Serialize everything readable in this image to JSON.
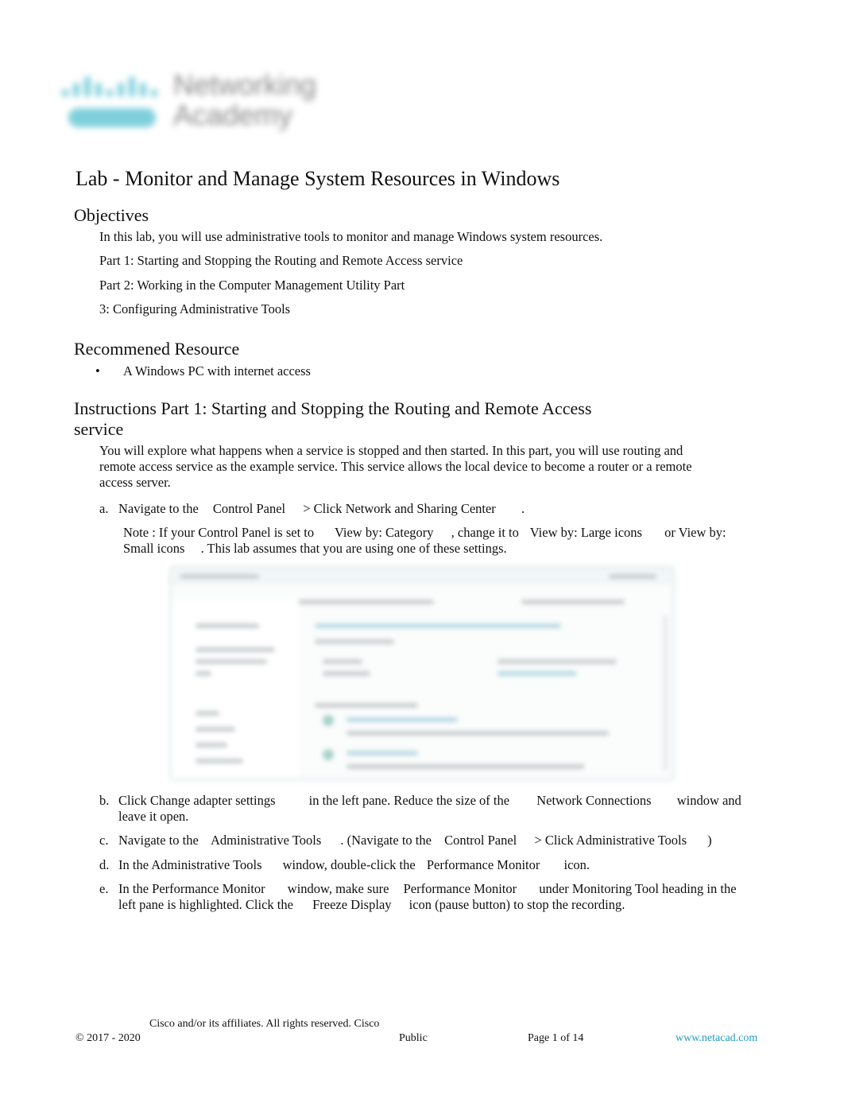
{
  "logo": {
    "line1": "Networking",
    "line2": "Academy",
    "brand_color": "#7fd0dc"
  },
  "title": "Lab - Monitor and Manage System Resources in Windows",
  "objectives": {
    "heading": "Objectives",
    "lines": [
      "In this lab, you will use administrative tools to monitor and manage Windows system resources.",
      "Part 1: Starting and Stopping the Routing and Remote Access service",
      "Part 2: Working in the Computer Management Utility Part",
      "3: Configuring Administrative Tools"
    ]
  },
  "resources": {
    "heading": "Recommened Resource",
    "bullet_symbol": "•",
    "items": [
      "A Windows PC with internet access"
    ]
  },
  "instructions": {
    "heading": "Instructions Part 1: Starting and Stopping the Routing and Remote Access service",
    "intro": "You will explore what happens when a service is stopped and then started. In this part, you will use routing and remote access service as the example service. This service allows the local device to become a router or a remote access server.",
    "steps": [
      {
        "label": "a.",
        "parts": [
          "Navigate to the",
          "Control Panel",
          "> Click",
          "Network and Sharing Center",
          "."
        ]
      },
      {
        "label": "b.",
        "parts": [
          "Click Change adapter settings",
          "in the left pane. Reduce the size of the",
          "Network Connections",
          "window and leave it open."
        ]
      },
      {
        "label": "c.",
        "parts": [
          "Navigate to the",
          "Administrative Tools",
          ". (Navigate to the",
          "Control Panel",
          "> Click Administrative Tools",
          ")"
        ]
      },
      {
        "label": "d.",
        "parts": [
          "In the",
          "Administrative Tools",
          "window, double-click the",
          "Performance Monitor",
          "icon."
        ]
      },
      {
        "label": "e.",
        "parts": [
          "In the",
          "Performance Monitor",
          "window, make sure",
          "Performance Monitor",
          "under Monitoring Tool heading in the left pane is highlighted. Click the",
          "Freeze Display",
          "icon (pause button) to stop the recording."
        ]
      }
    ],
    "note": {
      "parts": [
        "Note : If your Control Panel is set to",
        "View by: Category",
        ", change it to",
        "View by: Large icons",
        "or",
        "View by: Small icons",
        ". This lab assumes that you are using one of these settings."
      ]
    },
    "screenshot_alt": "Network and Sharing Center window (blurred)"
  },
  "footer": {
    "rights": "Cisco and/or its affiliates. All rights reserved. Cisco",
    "copyright": "© 2017 - 2020",
    "classification": "Public",
    "page_label": "Page",
    "page_num": "1 of 14",
    "link_text": "www.netacad.com",
    "link_color": "#1e9bc2"
  }
}
